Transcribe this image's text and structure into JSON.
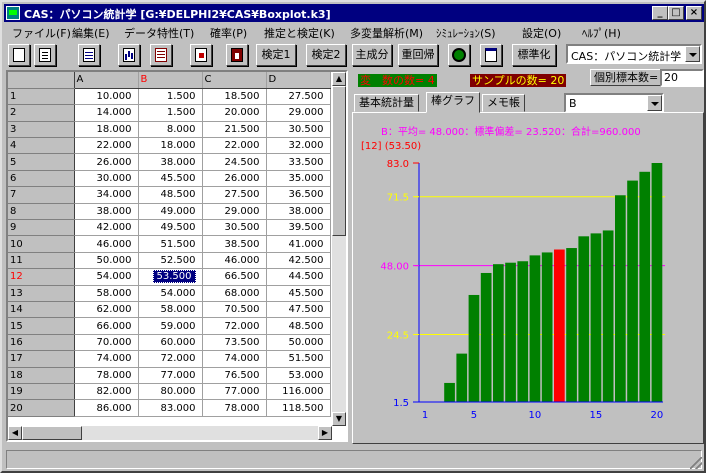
{
  "window": {
    "title": "CAS：パソコン統計学 [G:¥DELPHI2¥CAS¥Boxplot.k3]",
    "minimize": "_",
    "maximize": "□",
    "close": "×"
  },
  "menu": [
    "ファイル(F)",
    "編集(E)",
    "データ特性(T)",
    "確率(P)",
    "推定と検定(K)",
    "多変量解析(M)",
    "ｼﾐｭﾚｰｼｮﾝ(S)",
    "設定(O)",
    "ﾍﾙﾌﾟ(H)"
  ],
  "toolbar": {
    "test1": "検定1",
    "test2": "検定2",
    "pca": "主成分",
    "regression": "重回帰",
    "standardize": "標準化",
    "mode_value": "CAS：パソコン統計学"
  },
  "icons": {
    "new": "new-file-icon",
    "open": "open-file-icon",
    "grid": "data-grid-icon",
    "bars": "bar-chart-icon",
    "table": "table-icon",
    "export": "export-icon",
    "exit": "exit-icon",
    "gear": "settings-icon",
    "window": "window-icon"
  },
  "info": {
    "variables": "変　数の数= 4",
    "samples": "サンプルの数= 20",
    "individual_label": "個別標本数=",
    "individual_value": "20"
  },
  "tabs": [
    "基本統計量",
    "棒グラフ",
    "メモ帳"
  ],
  "active_tab": 1,
  "variable_select": "B",
  "grid": {
    "columns": [
      "A",
      "B",
      "C",
      "D"
    ],
    "selected_column": 1,
    "selected_row": 11,
    "rows": [
      {
        "label": "1",
        "values": [
          "10.000",
          "1.500",
          "18.500",
          "27.500"
        ]
      },
      {
        "label": "2",
        "values": [
          "14.000",
          "1.500",
          "20.000",
          "29.000"
        ]
      },
      {
        "label": "3",
        "values": [
          "18.000",
          "8.000",
          "21.500",
          "30.500"
        ]
      },
      {
        "label": "4",
        "values": [
          "22.000",
          "18.000",
          "22.000",
          "32.000"
        ]
      },
      {
        "label": "5",
        "values": [
          "26.000",
          "38.000",
          "24.500",
          "33.500"
        ]
      },
      {
        "label": "6",
        "values": [
          "30.000",
          "45.500",
          "26.000",
          "35.000"
        ]
      },
      {
        "label": "7",
        "values": [
          "34.000",
          "48.500",
          "27.500",
          "36.500"
        ]
      },
      {
        "label": "8",
        "values": [
          "38.000",
          "49.000",
          "29.000",
          "38.000"
        ]
      },
      {
        "label": "9",
        "values": [
          "42.000",
          "49.500",
          "30.500",
          "39.500"
        ]
      },
      {
        "label": "10",
        "values": [
          "46.000",
          "51.500",
          "38.500",
          "41.000"
        ]
      },
      {
        "label": "11",
        "values": [
          "50.000",
          "52.500",
          "46.000",
          "42.500"
        ]
      },
      {
        "label": "12",
        "values": [
          "54.000",
          "53.500",
          "66.500",
          "44.500"
        ]
      },
      {
        "label": "13",
        "values": [
          "58.000",
          "54.000",
          "68.000",
          "45.500"
        ]
      },
      {
        "label": "14",
        "values": [
          "62.000",
          "58.000",
          "70.500",
          "47.500"
        ]
      },
      {
        "label": "15",
        "values": [
          "66.000",
          "59.000",
          "72.000",
          "48.500"
        ]
      },
      {
        "label": "16",
        "values": [
          "70.000",
          "60.000",
          "73.500",
          "50.000"
        ]
      },
      {
        "label": "17",
        "values": [
          "74.000",
          "72.000",
          "74.000",
          "51.500"
        ]
      },
      {
        "label": "18",
        "values": [
          "78.000",
          "77.000",
          "76.500",
          "53.000"
        ]
      },
      {
        "label": "19",
        "values": [
          "82.000",
          "80.000",
          "77.000",
          "116.000"
        ]
      },
      {
        "label": "20",
        "values": [
          "86.000",
          "83.000",
          "78.000",
          "118.500"
        ]
      }
    ]
  },
  "chart_data": {
    "type": "bar",
    "title": "B：平均= 48.000：標準偏差= 23.520：合計=960.000",
    "annotation": "[12] (53.50)",
    "x": [
      1,
      2,
      3,
      4,
      5,
      6,
      7,
      8,
      9,
      10,
      11,
      12,
      13,
      14,
      15,
      16,
      17,
      18,
      19,
      20
    ],
    "values": [
      1.5,
      1.5,
      8.0,
      18.0,
      38.0,
      45.5,
      48.5,
      49.0,
      49.5,
      51.5,
      52.5,
      53.5,
      54.0,
      58.0,
      59.0,
      60.0,
      72.0,
      77.0,
      80.0,
      83.0
    ],
    "highlight_index": 11,
    "ylim": [
      1.5,
      83.0
    ],
    "yticks": [
      {
        "value": 1.5,
        "label": "1.5"
      },
      {
        "value": 24.5,
        "label": "24.5"
      },
      {
        "value": 48.0,
        "label": "48.00"
      },
      {
        "value": 71.5,
        "label": "71.5"
      },
      {
        "value": 83.0,
        "label": "83.0"
      }
    ],
    "xticks": [
      1,
      5,
      10,
      15,
      20
    ],
    "reference_lines": [
      {
        "value": 24.5,
        "color": "#ffff00"
      },
      {
        "value": 48.0,
        "color": "#ff00ff"
      },
      {
        "value": 71.5,
        "color": "#ffff00"
      }
    ],
    "bar_color": "#008000",
    "highlight_color": "#ff0000",
    "axis_color": "#0000ff"
  }
}
